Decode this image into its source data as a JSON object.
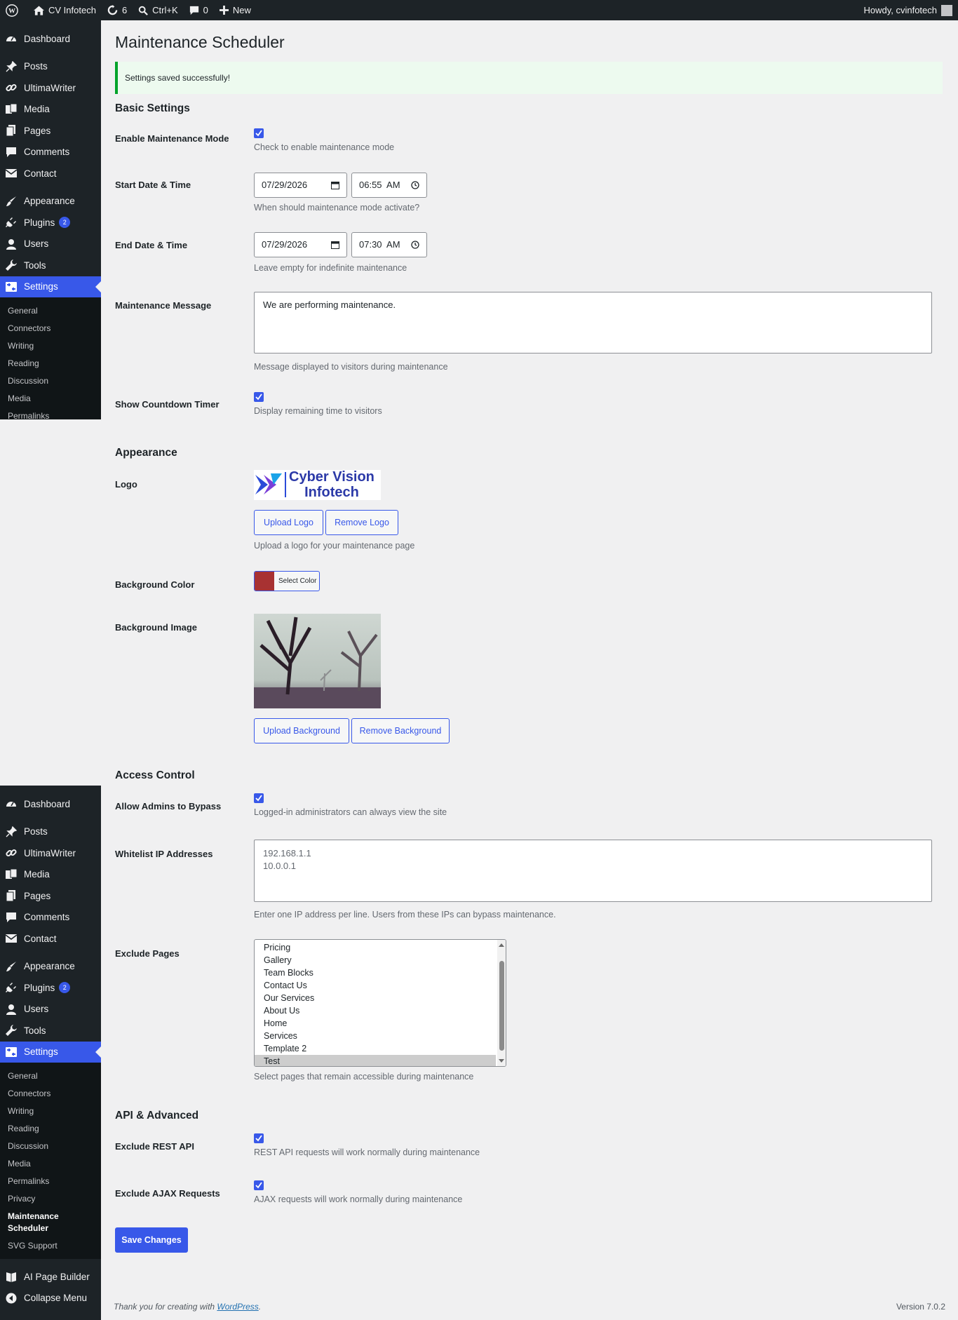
{
  "adminbar": {
    "site_name": "CV Infotech",
    "updates_count": "6",
    "search_shortcut": "Ctrl+K",
    "comments_count": "0",
    "new_label": "New",
    "howdy": "Howdy, cvinfotech"
  },
  "menu": {
    "dashboard": "Dashboard",
    "posts": "Posts",
    "ultimawriter": "UltimaWriter",
    "media": "Media",
    "pages": "Pages",
    "comments": "Comments",
    "contact": "Contact",
    "appearance": "Appearance",
    "plugins": "Plugins",
    "plugins_badge": "2",
    "users": "Users",
    "tools": "Tools",
    "settings": "Settings",
    "ai_page_builder": "AI Page Builder",
    "collapse": "Collapse Menu"
  },
  "submenu": {
    "general": "General",
    "connectors": "Connectors",
    "writing": "Writing",
    "reading": "Reading",
    "discussion": "Discussion",
    "media": "Media",
    "permalinks": "Permalinks",
    "privacy": "Privacy",
    "maintenance_scheduler": "Maintenance Scheduler",
    "svg_support": "SVG Support"
  },
  "page": {
    "title": "Maintenance Scheduler",
    "notice": "Settings saved successfully!"
  },
  "basic": {
    "heading": "Basic Settings",
    "enable_label": "Enable Maintenance Mode",
    "enable_desc": "Check to enable maintenance mode",
    "enable_checked": true,
    "start_label": "Start Date & Time",
    "start_date": "07/29/2026",
    "start_time": "06:55  AM",
    "start_desc": "When should maintenance mode activate?",
    "end_label": "End Date & Time",
    "end_date": "07/29/2026",
    "end_time": "07:30  AM",
    "end_desc": "Leave empty for indefinite maintenance",
    "message_label": "Maintenance Message",
    "message_value": "We are performing maintenance.",
    "message_desc": "Message displayed to visitors during maintenance",
    "countdown_label": "Show Countdown Timer",
    "countdown_desc": "Display remaining time to visitors",
    "countdown_checked": true
  },
  "appearance": {
    "heading": "Appearance",
    "logo_label": "Logo",
    "logo_text_line1": "Cyber Vision",
    "logo_text_line2": "Infotech",
    "upload_logo": "Upload Logo",
    "remove_logo": "Remove Logo",
    "logo_desc": "Upload a logo for your maintenance page",
    "bg_color_label": "Background Color",
    "bg_color_value": "#a83232",
    "select_color": "Select Color",
    "bg_image_label": "Background Image",
    "upload_bg": "Upload Background",
    "remove_bg": "Remove Background"
  },
  "access": {
    "heading": "Access Control",
    "bypass_label": "Allow Admins to Bypass",
    "bypass_desc": "Logged-in administrators can always view the site",
    "bypass_checked": true,
    "whitelist_label": "Whitelist IP Addresses",
    "whitelist_placeholder_1": "192.168.1.1",
    "whitelist_placeholder_2": "10.0.0.1",
    "whitelist_desc": "Enter one IP address per line. Users from these IPs can bypass maintenance.",
    "exclude_label": "Exclude Pages",
    "exclude_options": [
      "Pricing",
      "Gallery",
      "Team Blocks",
      "Contact Us",
      "Our Services",
      "About Us",
      "Home",
      "Services",
      "Template 2",
      "Test"
    ],
    "exclude_selected": "Test",
    "exclude_desc": "Select pages that remain accessible during maintenance"
  },
  "api": {
    "heading": "API & Advanced",
    "rest_label": "Exclude REST API",
    "rest_desc": "REST API requests will work normally during maintenance",
    "rest_checked": true,
    "ajax_label": "Exclude AJAX Requests",
    "ajax_desc": "AJAX requests will work normally during maintenance",
    "ajax_checked": true,
    "save": "Save Changes"
  },
  "footer": {
    "thanks": "Thank you for creating with ",
    "wp_link": "WordPress",
    "thanks_end": ".",
    "version": "Version 7.0.2"
  },
  "colors": {
    "accent": "#3858e9",
    "adminbar": "#1d2327",
    "notice_border": "#00a32a"
  }
}
